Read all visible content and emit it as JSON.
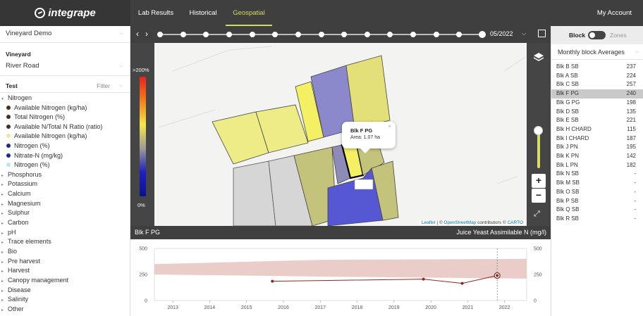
{
  "app": {
    "logo_text": "integrape",
    "nav_tabs": [
      "Lab Results",
      "Historical",
      "Geospatial"
    ],
    "active_tab": "Geospatial",
    "account_label": "My Account"
  },
  "sidebar": {
    "vineyard_group": "Vineyard Demo",
    "vineyard_label": "Vineyard",
    "vineyard_value": "River Road",
    "test_label": "Test",
    "filter_label": "Filter",
    "nitrogen_group": "Nitrogen",
    "nitrogen_items": [
      {
        "label": "Available Nitrogen (kg/ha)",
        "color": "#4a3020"
      },
      {
        "label": "Total Nitrogen (%)",
        "color": "#4a3020"
      },
      {
        "label": "Available N/Total N Ratio (ratio)",
        "color": "#4a3020"
      },
      {
        "label": "Available Nitrogen (kg/ha)",
        "color": "#f2e6a0"
      },
      {
        "label": "Nitrogen (%)",
        "color": "#1f2a8c"
      },
      {
        "label": "Nitrate-N (mg/kg)",
        "color": "#1f2a8c"
      },
      {
        "label": "Nitrogen (%)",
        "color": "#bfe3f2"
      }
    ],
    "groups": [
      "Phosphorus",
      "Potassium",
      "Calcium",
      "Magnesium",
      "Sulphur",
      "Carbon",
      "pH",
      "Trace elements",
      "Bio",
      "Pre harvest",
      "Harvest",
      "Canopy management",
      "Disease",
      "Salinity",
      "Other"
    ]
  },
  "timeline": {
    "date": "05/2022",
    "position": 1.0
  },
  "map": {
    "legend_max": ">200%",
    "legend_min": "0%",
    "popup": {
      "title": "Blk F PG",
      "area": "Area: 1.07 ha",
      "close": "×"
    },
    "zoom_in": "+",
    "zoom_out": "−",
    "attribution_leaflet": "Leaflet",
    "attribution_sep1": " | © ",
    "attribution_osm": "OpenStreetMap",
    "attribution_mid": " contributors © ",
    "attribution_carto": "CARTO"
  },
  "chart_header": {
    "block": "Blk F PG",
    "metric": "Juice Yeast Assimilable N (mg/l)"
  },
  "chart_data": {
    "type": "line",
    "x_ticks": [
      "2013",
      "2014",
      "2015",
      "2016",
      "2017",
      "2018",
      "2019",
      "2020",
      "2021",
      "2022"
    ],
    "y_ticks": [
      "500",
      "250",
      "0"
    ],
    "ylim": [
      0,
      500
    ],
    "xlim": [
      2012.5,
      2022.6
    ],
    "series": [
      {
        "x": [
          2015.7,
          2019.8,
          2020.85,
          2021.8
        ],
        "values": [
          185,
          205,
          165,
          240
        ]
      }
    ],
    "band": {
      "x": [
        2012.5,
        2017.0,
        2022.6
      ],
      "upper": [
        350,
        390,
        400
      ],
      "lower": [
        250,
        230,
        210
      ]
    },
    "marker_x": 2021.8,
    "band_color": "#e8c8c2",
    "line_color": "#8a2a1e"
  },
  "rpanel": {
    "toggle_block": "Block",
    "toggle_zones": "Zones",
    "averages_label": "Monthly block Averages",
    "blocks": [
      {
        "name": "Blk B SB",
        "value": "237"
      },
      {
        "name": "Blk A SB",
        "value": "224"
      },
      {
        "name": "Blk C SB",
        "value": "257"
      },
      {
        "name": "Blk F PG",
        "value": "240"
      },
      {
        "name": "Blk G PG",
        "value": "198"
      },
      {
        "name": "Blk D SB",
        "value": "135"
      },
      {
        "name": "Blk E SB",
        "value": "221"
      },
      {
        "name": "Blk H CHARD",
        "value": "115"
      },
      {
        "name": "Blk I CHARD",
        "value": "187"
      },
      {
        "name": "Blk J PN",
        "value": "195"
      },
      {
        "name": "Blk K PN",
        "value": "142"
      },
      {
        "name": "Blk L PN",
        "value": "182"
      },
      {
        "name": "Blk N SB",
        "value": "-"
      },
      {
        "name": "Blk M SB",
        "value": "-"
      },
      {
        "name": "Blk O SB",
        "value": "-"
      },
      {
        "name": "Blk P SB",
        "value": "-"
      },
      {
        "name": "Blk Q SB",
        "value": "-"
      },
      {
        "name": "Blk R SB",
        "value": "-"
      }
    ],
    "selected": "Blk F PG"
  }
}
